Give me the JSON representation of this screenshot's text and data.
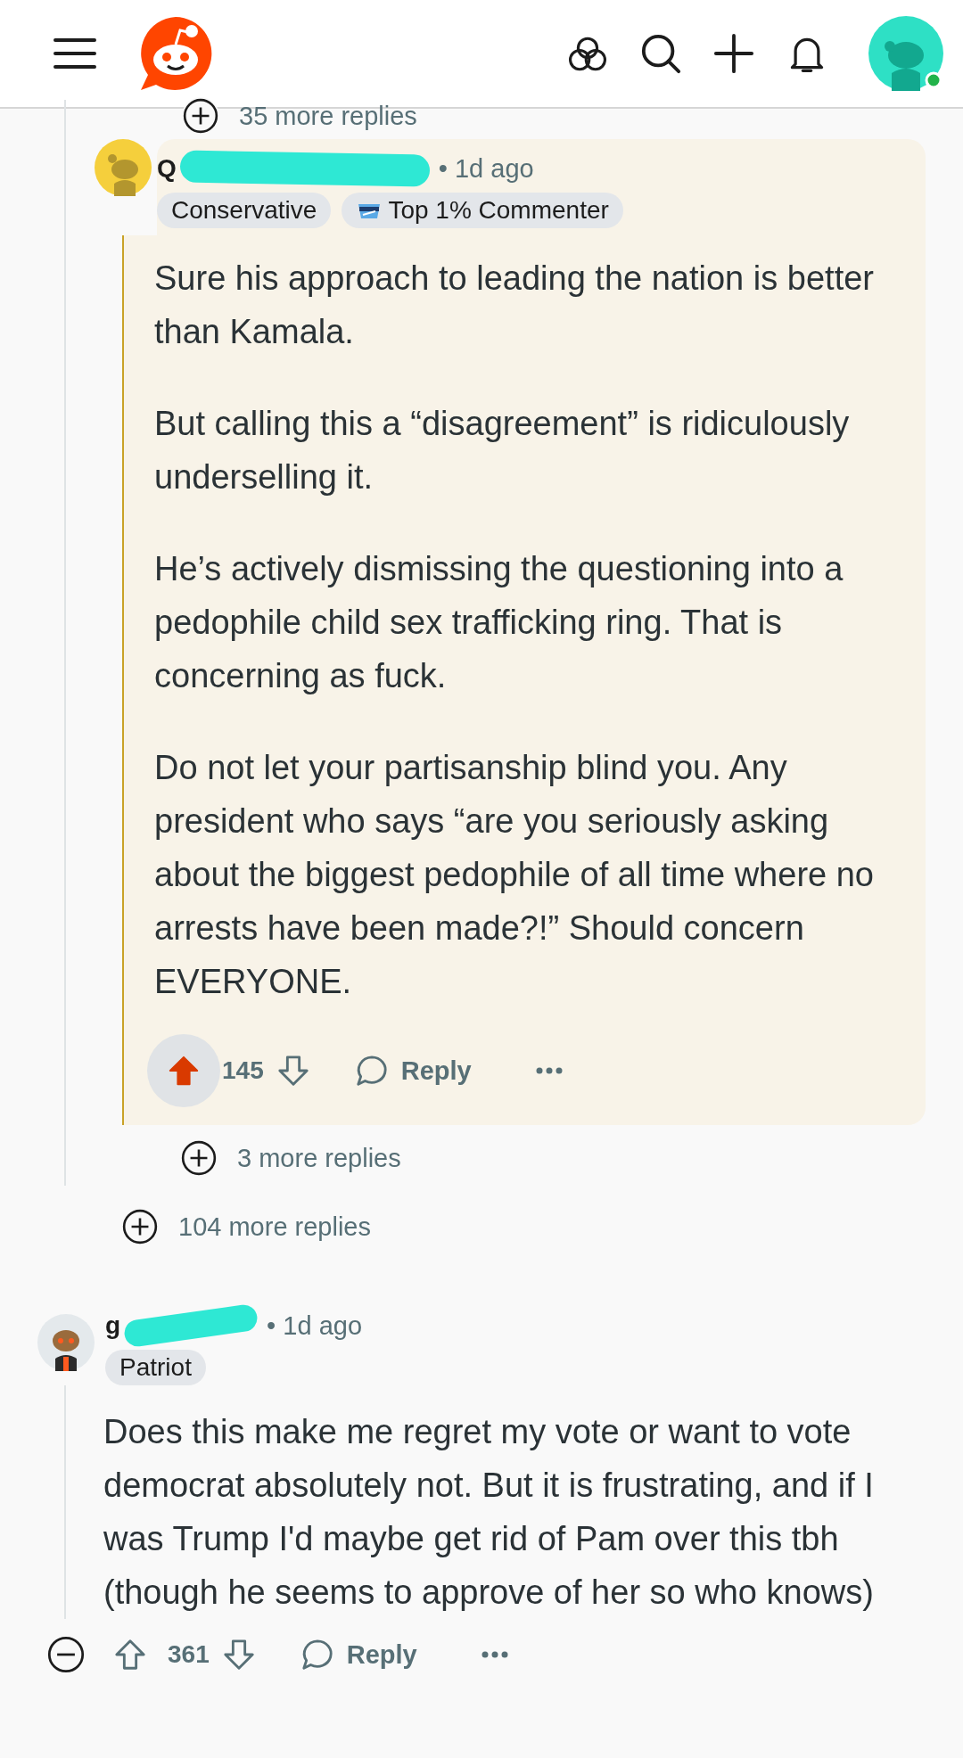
{
  "collapsed_above": {
    "label": "35 more replies"
  },
  "reply": {
    "username": "Q",
    "time": "• 1d ago",
    "flairs": [
      {
        "kind": "text",
        "label": "Conservative"
      },
      {
        "kind": "achievement",
        "label": "Top 1% Commenter"
      }
    ],
    "paragraphs": [
      "Sure his approach to leading the nation is better than Kamala.",
      "But calling this a “disagreement” is ridiculously underselling it.",
      "He’s actively dismissing the questioning into a pedophile child sex trafficking ring. That is concerning as fuck.",
      "Do not let your partisanship blind you. Any president who says “are you seriously asking about the biggest pedophile of all time where no arrests have been made?!” Should concern EVERYONE."
    ],
    "score": "145",
    "upvoted": true,
    "reply_label": "Reply",
    "more_replies": "3 more replies"
  },
  "thread_more_replies": "104 more replies",
  "comment": {
    "username": "g",
    "time": "• 1d ago",
    "flairs": [
      {
        "kind": "text",
        "label": "Patriot"
      }
    ],
    "paragraphs": [
      "Does this make me regret my vote or want to vote democrat absolutely not. But it is frustrating, and if I was Trump I'd maybe get rid of Pam over this tbh (though he seems to approve of her so who knows)"
    ],
    "score": "361",
    "upvoted": false,
    "reply_label": "Reply",
    "expanded": true
  }
}
